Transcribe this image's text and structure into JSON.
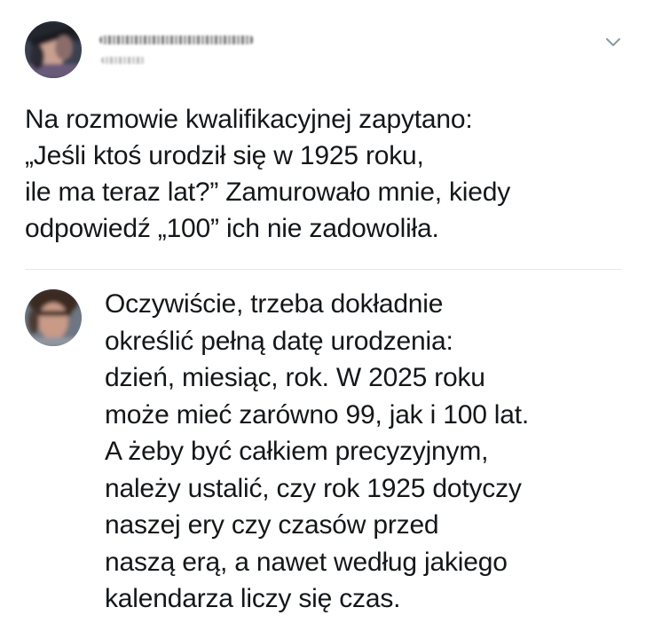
{
  "tweet": {
    "lines": [
      "Na rozmowie kwalifikacyjnej zapytano:",
      "„Jeśli ktoś urodził się w 1925 roku,",
      "ile ma teraz lat?” Zamurowało mnie, kiedy",
      "odpowiedź „100” ich nie zadowoliła."
    ]
  },
  "reply": {
    "lines": [
      "Oczywiście, trzeba dokładnie",
      "określić pełną datę urodzenia:",
      "dzień, miesiąc, rok. W 2025 roku",
      "może mieć zarówno 99, jak i 100 lat.",
      "A żeby być całkiem precyzyjnym,",
      "należy ustalić, czy rok 1925 dotyczy",
      "naszej ery czy czasów przed",
      "naszą erą, a nawet według jakiego",
      "kalendarza liczy się czas."
    ]
  },
  "icons": {
    "menu": "chevron-down-icon"
  },
  "colors": {
    "text": "#14171a",
    "divider": "#e1e8ed",
    "chevron": "#8899a6"
  }
}
